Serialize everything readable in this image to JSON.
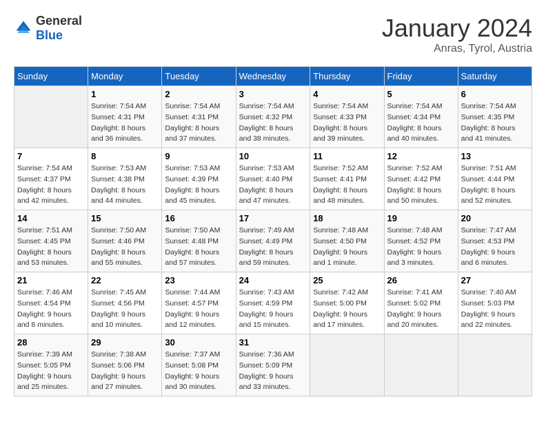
{
  "header": {
    "logo_general": "General",
    "logo_blue": "Blue",
    "month": "January 2024",
    "location": "Anras, Tyrol, Austria"
  },
  "weekdays": [
    "Sunday",
    "Monday",
    "Tuesday",
    "Wednesday",
    "Thursday",
    "Friday",
    "Saturday"
  ],
  "weeks": [
    [
      {
        "day": "",
        "empty": true
      },
      {
        "day": "1",
        "sunrise": "7:54 AM",
        "sunset": "4:31 PM",
        "daylight": "8 hours and 36 minutes."
      },
      {
        "day": "2",
        "sunrise": "7:54 AM",
        "sunset": "4:31 PM",
        "daylight": "8 hours and 37 minutes."
      },
      {
        "day": "3",
        "sunrise": "7:54 AM",
        "sunset": "4:32 PM",
        "daylight": "8 hours and 38 minutes."
      },
      {
        "day": "4",
        "sunrise": "7:54 AM",
        "sunset": "4:33 PM",
        "daylight": "8 hours and 39 minutes."
      },
      {
        "day": "5",
        "sunrise": "7:54 AM",
        "sunset": "4:34 PM",
        "daylight": "8 hours and 40 minutes."
      },
      {
        "day": "6",
        "sunrise": "7:54 AM",
        "sunset": "4:35 PM",
        "daylight": "8 hours and 41 minutes."
      }
    ],
    [
      {
        "day": "7",
        "sunrise": "7:54 AM",
        "sunset": "4:37 PM",
        "daylight": "8 hours and 42 minutes."
      },
      {
        "day": "8",
        "sunrise": "7:53 AM",
        "sunset": "4:38 PM",
        "daylight": "8 hours and 44 minutes."
      },
      {
        "day": "9",
        "sunrise": "7:53 AM",
        "sunset": "4:39 PM",
        "daylight": "8 hours and 45 minutes."
      },
      {
        "day": "10",
        "sunrise": "7:53 AM",
        "sunset": "4:40 PM",
        "daylight": "8 hours and 47 minutes."
      },
      {
        "day": "11",
        "sunrise": "7:52 AM",
        "sunset": "4:41 PM",
        "daylight": "8 hours and 48 minutes."
      },
      {
        "day": "12",
        "sunrise": "7:52 AM",
        "sunset": "4:42 PM",
        "daylight": "8 hours and 50 minutes."
      },
      {
        "day": "13",
        "sunrise": "7:51 AM",
        "sunset": "4:44 PM",
        "daylight": "8 hours and 52 minutes."
      }
    ],
    [
      {
        "day": "14",
        "sunrise": "7:51 AM",
        "sunset": "4:45 PM",
        "daylight": "8 hours and 53 minutes."
      },
      {
        "day": "15",
        "sunrise": "7:50 AM",
        "sunset": "4:46 PM",
        "daylight": "8 hours and 55 minutes."
      },
      {
        "day": "16",
        "sunrise": "7:50 AM",
        "sunset": "4:48 PM",
        "daylight": "8 hours and 57 minutes."
      },
      {
        "day": "17",
        "sunrise": "7:49 AM",
        "sunset": "4:49 PM",
        "daylight": "8 hours and 59 minutes."
      },
      {
        "day": "18",
        "sunrise": "7:48 AM",
        "sunset": "4:50 PM",
        "daylight": "9 hours and 1 minute."
      },
      {
        "day": "19",
        "sunrise": "7:48 AM",
        "sunset": "4:52 PM",
        "daylight": "9 hours and 3 minutes."
      },
      {
        "day": "20",
        "sunrise": "7:47 AM",
        "sunset": "4:53 PM",
        "daylight": "9 hours and 6 minutes."
      }
    ],
    [
      {
        "day": "21",
        "sunrise": "7:46 AM",
        "sunset": "4:54 PM",
        "daylight": "9 hours and 8 minutes."
      },
      {
        "day": "22",
        "sunrise": "7:45 AM",
        "sunset": "4:56 PM",
        "daylight": "9 hours and 10 minutes."
      },
      {
        "day": "23",
        "sunrise": "7:44 AM",
        "sunset": "4:57 PM",
        "daylight": "9 hours and 12 minutes."
      },
      {
        "day": "24",
        "sunrise": "7:43 AM",
        "sunset": "4:59 PM",
        "daylight": "9 hours and 15 minutes."
      },
      {
        "day": "25",
        "sunrise": "7:42 AM",
        "sunset": "5:00 PM",
        "daylight": "9 hours and 17 minutes."
      },
      {
        "day": "26",
        "sunrise": "7:41 AM",
        "sunset": "5:02 PM",
        "daylight": "9 hours and 20 minutes."
      },
      {
        "day": "27",
        "sunrise": "7:40 AM",
        "sunset": "5:03 PM",
        "daylight": "9 hours and 22 minutes."
      }
    ],
    [
      {
        "day": "28",
        "sunrise": "7:39 AM",
        "sunset": "5:05 PM",
        "daylight": "9 hours and 25 minutes."
      },
      {
        "day": "29",
        "sunrise": "7:38 AM",
        "sunset": "5:06 PM",
        "daylight": "9 hours and 27 minutes."
      },
      {
        "day": "30",
        "sunrise": "7:37 AM",
        "sunset": "5:08 PM",
        "daylight": "9 hours and 30 minutes."
      },
      {
        "day": "31",
        "sunrise": "7:36 AM",
        "sunset": "5:09 PM",
        "daylight": "9 hours and 33 minutes."
      },
      {
        "day": "",
        "empty": true
      },
      {
        "day": "",
        "empty": true
      },
      {
        "day": "",
        "empty": true
      }
    ]
  ],
  "labels": {
    "sunrise": "Sunrise:",
    "sunset": "Sunset:",
    "daylight": "Daylight:"
  }
}
